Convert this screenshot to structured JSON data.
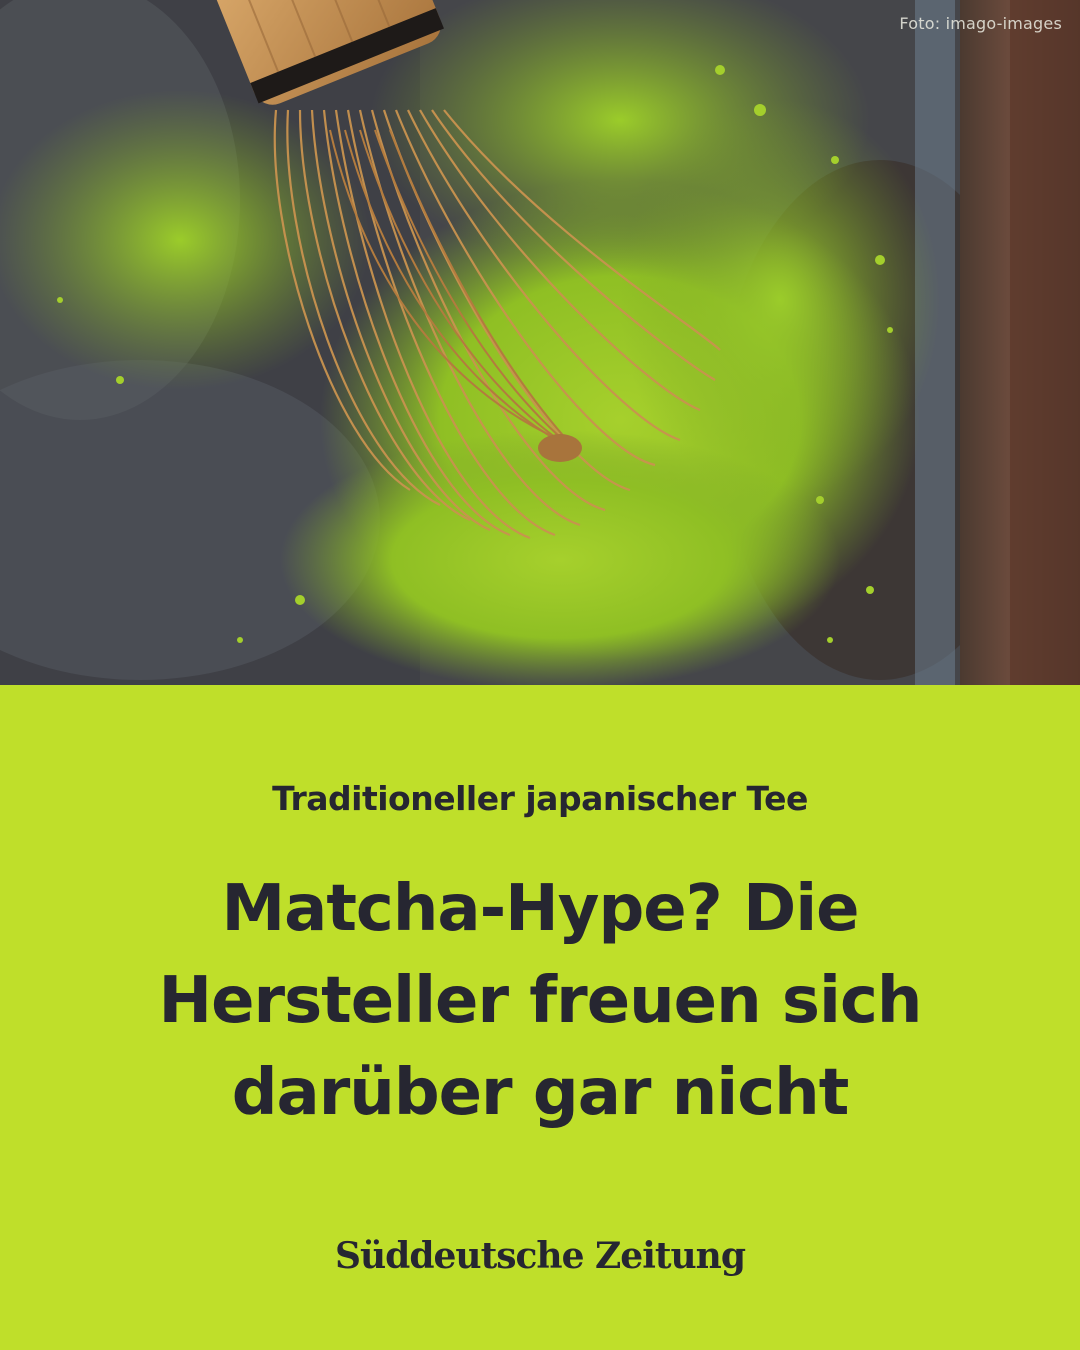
{
  "photo": {
    "credit": "Foto: imago-images",
    "subject_icon": "matcha-whisk-image"
  },
  "article": {
    "kicker": "Traditioneller japanischer Tee",
    "headline": "Matcha-Hype? Die Hersteller freuen sich darüber gar nicht"
  },
  "brand": {
    "logo_text": "Süddeutsche Zeitung"
  },
  "colors": {
    "panel_background": "#bfdf2a",
    "text": "#262631",
    "matcha": "#9ccc28"
  }
}
